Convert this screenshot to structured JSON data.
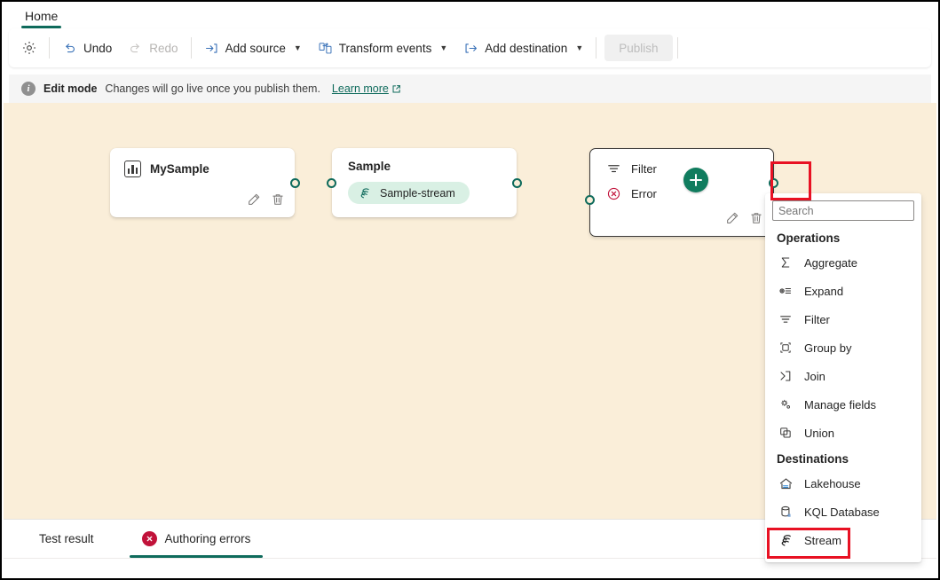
{
  "ribbon": {
    "tabs": [
      {
        "label": "Home",
        "active": true
      }
    ]
  },
  "toolbar": {
    "settings_icon": "gear-icon",
    "undo_label": "Undo",
    "redo_label": "Redo",
    "add_source_label": "Add source",
    "transform_events_label": "Transform events",
    "add_destination_label": "Add destination",
    "publish_label": "Publish",
    "publish_disabled": true,
    "redo_disabled": true
  },
  "infobar": {
    "icon": "info-icon",
    "mode_label": "Edit mode",
    "message": "Changes will go live once you publish them.",
    "link_label": "Learn more",
    "link_icon": "external-link-icon"
  },
  "canvas": {
    "background": "#faeed9",
    "nodes": [
      {
        "id": "mysample",
        "title": "MySample",
        "icon": "bar-chart-icon",
        "actions": [
          "edit-icon",
          "delete-icon"
        ]
      },
      {
        "id": "sample",
        "title": "Sample",
        "pill_label": "Sample-stream",
        "pill_icon": "stream-icon",
        "pill_color": "#d9f0e4"
      },
      {
        "id": "filter",
        "title": "Filter",
        "icon": "filter-icon",
        "error_label": "Error",
        "error_icon": "error-circle-icon",
        "selected": true,
        "actions": [
          "edit-icon",
          "delete-icon"
        ]
      }
    ],
    "add_button": {
      "icon": "plus-icon",
      "color": "#107c5e"
    },
    "highlight_color": "#e81123"
  },
  "dropdown": {
    "search_placeholder": "Search",
    "search_value": "",
    "sections": [
      {
        "header": "Operations",
        "items": [
          {
            "label": "Aggregate",
            "icon": "sigma-icon"
          },
          {
            "label": "Expand",
            "icon": "expand-icon"
          },
          {
            "label": "Filter",
            "icon": "filter-icon"
          },
          {
            "label": "Group by",
            "icon": "group-by-icon"
          },
          {
            "label": "Join",
            "icon": "join-icon"
          },
          {
            "label": "Manage fields",
            "icon": "manage-fields-icon"
          },
          {
            "label": "Union",
            "icon": "union-icon"
          }
        ]
      },
      {
        "header": "Destinations",
        "items": [
          {
            "label": "Lakehouse",
            "icon": "lakehouse-icon"
          },
          {
            "label": "KQL Database",
            "icon": "kql-database-icon"
          },
          {
            "label": "Stream",
            "icon": "stream-icon",
            "highlighted": true
          }
        ]
      }
    ]
  },
  "bottom_panel": {
    "tabs": [
      {
        "label": "Test result",
        "active": false
      },
      {
        "label": "Authoring errors",
        "active": true,
        "badge_icon": "error-circle-icon",
        "badge_color": "#c1123a"
      }
    ]
  }
}
